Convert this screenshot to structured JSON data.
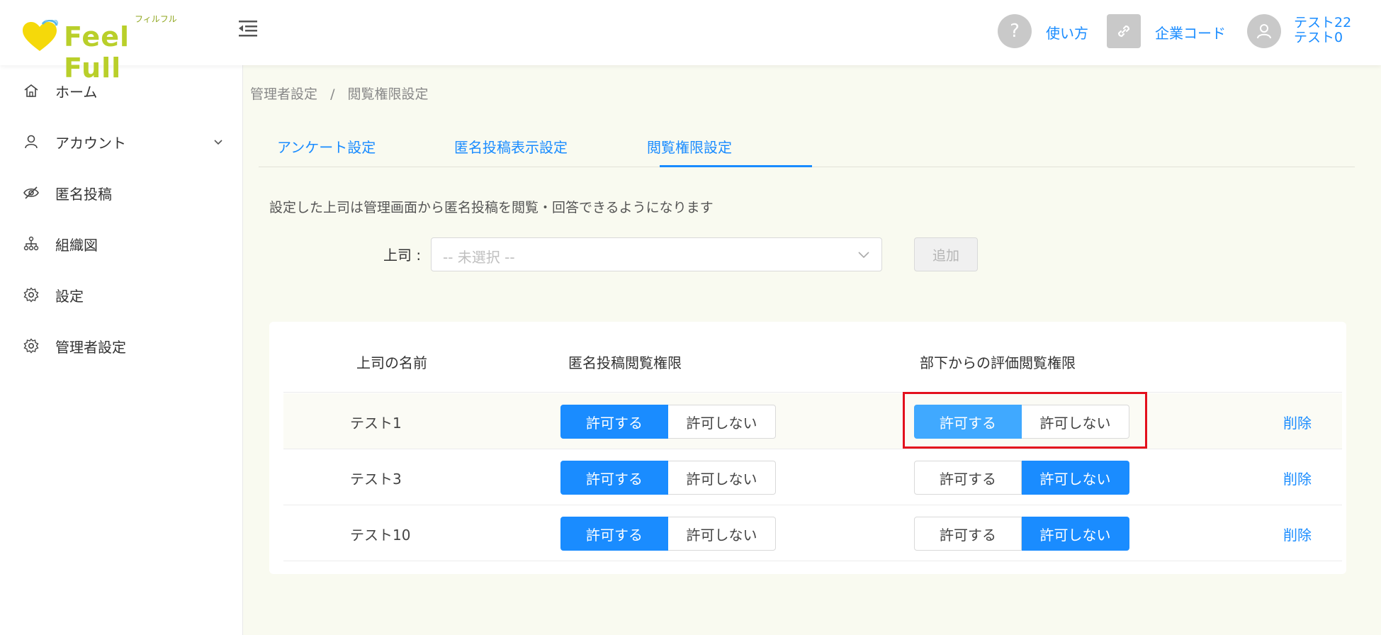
{
  "app": {
    "logo_text": "Feel Full",
    "logo_ruby": "フィルフル"
  },
  "header": {
    "help_label": "使い方",
    "company_code_label": "企業コード",
    "user_name_line1": "テスト22",
    "user_name_line2": "テスト0",
    "help_icon_glyph": "?"
  },
  "sidebar": {
    "items": [
      {
        "label": "ホーム",
        "icon": "home-icon"
      },
      {
        "label": "アカウント",
        "icon": "user-icon",
        "expandable": true
      },
      {
        "label": "匿名投稿",
        "icon": "eye-off-icon"
      },
      {
        "label": "組織図",
        "icon": "org-chart-icon"
      },
      {
        "label": "設定",
        "icon": "gear-icon"
      },
      {
        "label": "管理者設定",
        "icon": "gear-icon"
      }
    ]
  },
  "breadcrumb": {
    "items": [
      "管理者設定",
      "/",
      "閲覧権限設定"
    ]
  },
  "tabs": [
    {
      "label": "アンケート設定",
      "active": false
    },
    {
      "label": "匿名投稿表示設定",
      "active": false
    },
    {
      "label": "閲覧権限設定",
      "active": true
    }
  ],
  "form": {
    "description": "設定した上司は管理画面から匿名投稿を閲覧・回答できるようになります",
    "boss_label": "上司 :",
    "select_placeholder": "-- 未選択 --",
    "add_button": "追加"
  },
  "table": {
    "headers": [
      "上司の名前",
      "匿名投稿閲覧権限",
      "部下からの評価閲覧権限"
    ],
    "allow_label": "許可する",
    "deny_label": "許可しない",
    "delete_label": "削除",
    "rows": [
      {
        "name": "テスト1",
        "anon_view": "許可する",
        "eval_view": "許可する"
      },
      {
        "name": "テスト3",
        "anon_view": "許可する",
        "eval_view": "許可しない"
      },
      {
        "name": "テスト10",
        "anon_view": "許可する",
        "eval_view": "許可しない"
      }
    ]
  },
  "colors": {
    "accent": "#1a8cff",
    "logo_green": "#b9cf2a",
    "logo_heart": "#f5d90a",
    "highlight": "#e3101d",
    "main_bg": "#f9faf0"
  }
}
